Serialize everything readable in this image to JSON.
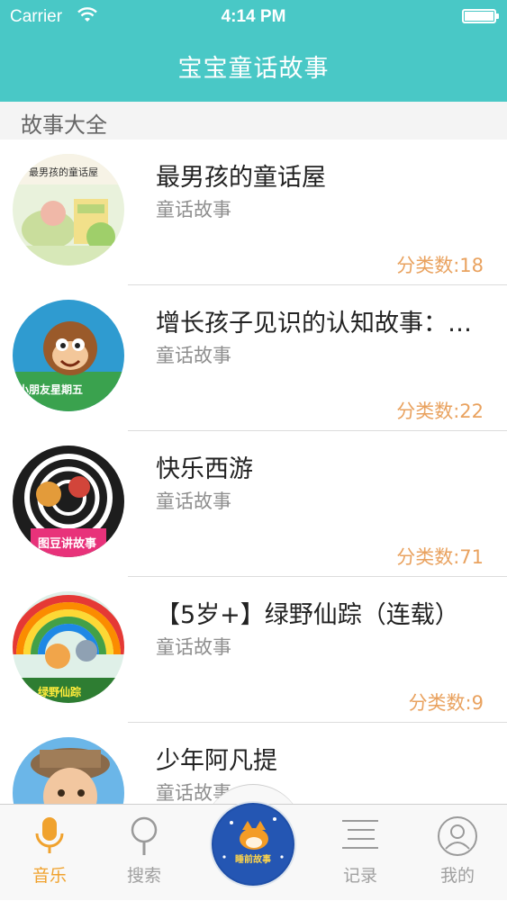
{
  "status_bar": {
    "carrier": "Carrier",
    "time": "4:14 PM"
  },
  "nav": {
    "title": "宝宝童话故事"
  },
  "section": {
    "title": "故事大全"
  },
  "list": {
    "items": [
      {
        "title": "最男孩的童话屋",
        "subtitle": "童话故事",
        "count": "分类数:18",
        "thumb_text": "最男孩的童话屋"
      },
      {
        "title": "增长孩子见识的认知故事：小…",
        "subtitle": "童话故事",
        "count": "分类数:22",
        "thumb_text": "小朋友星期五"
      },
      {
        "title": "快乐西游",
        "subtitle": "童话故事",
        "count": "分类数:71",
        "thumb_text": "图豆讲故事"
      },
      {
        "title": "【5岁+】绿野仙踪（连载）",
        "subtitle": "童话故事",
        "count": "分类数:9",
        "thumb_text": "绿野仙踪"
      },
      {
        "title": "少年阿凡提",
        "subtitle": "童话故事",
        "count": "",
        "thumb_text": ""
      }
    ]
  },
  "tabbar": {
    "tabs": [
      {
        "label": "音乐",
        "icon": "microphone-icon",
        "active": true
      },
      {
        "label": "搜索",
        "icon": "search-icon",
        "active": false
      },
      {
        "label": "",
        "icon": "story-logo-icon",
        "active": false,
        "center_text": "睡前故事"
      },
      {
        "label": "记录",
        "icon": "list-icon",
        "active": false
      },
      {
        "label": "我的",
        "icon": "profile-icon",
        "active": false
      }
    ]
  },
  "colors": {
    "header": "#49c8c6",
    "accent_orange": "#f0a22e",
    "count_orange": "#e9a25f",
    "subtitle_gray": "#8e8e8e"
  }
}
